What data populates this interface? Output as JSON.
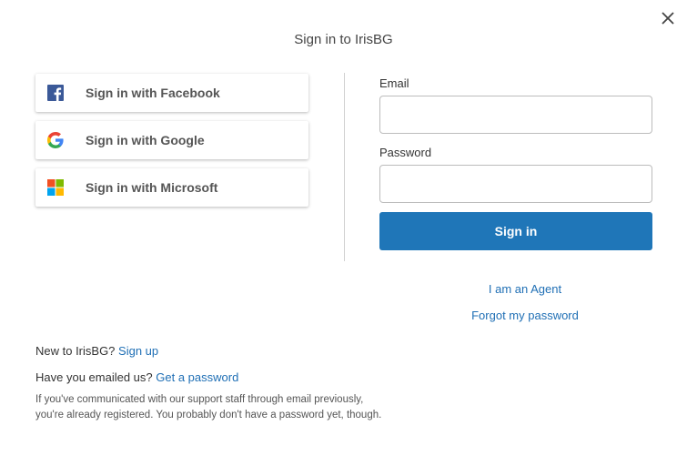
{
  "dialog": {
    "title": "Sign in to IrisBG",
    "close_icon": "close-icon"
  },
  "social": [
    {
      "label": "Sign in with Facebook",
      "icon": "facebook-icon",
      "color": "#3b5998"
    },
    {
      "label": "Sign in with Google",
      "icon": "google-icon"
    },
    {
      "label": "Sign in with Microsoft",
      "icon": "microsoft-icon"
    }
  ],
  "form": {
    "email_label": "Email",
    "email_value": "",
    "password_label": "Password",
    "password_value": "",
    "signin_label": "Sign in",
    "signin_color": "#1f76b8"
  },
  "links": {
    "agent": "I am an Agent",
    "forgot": "Forgot my password"
  },
  "footer": {
    "new_prefix": "New to IrisBG?",
    "signup": "Sign up",
    "emailed_prefix": "Have you emailed us?",
    "get_password": "Get a password",
    "note_line1": "If you've communicated with our support staff through email previously,",
    "note_line2": "you're already registered. You probably don't have a password yet, though."
  },
  "colors": {
    "link": "#1f6fb5"
  }
}
